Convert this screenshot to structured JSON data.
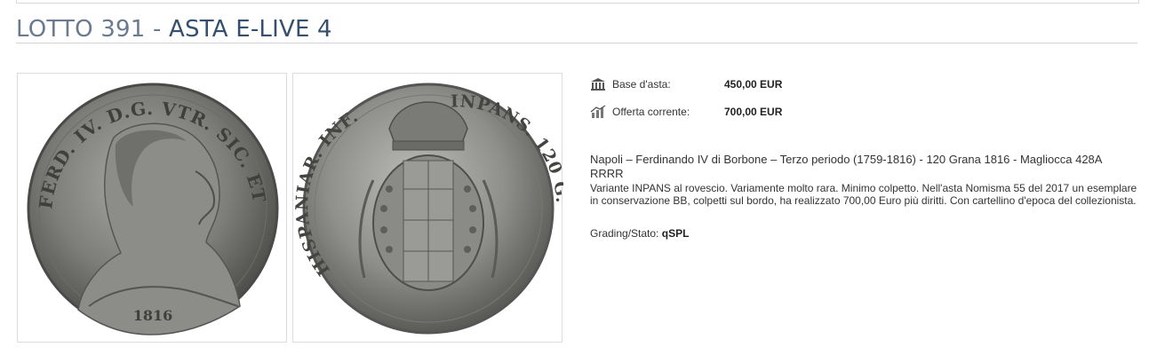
{
  "header": {
    "lot": "LOTTO 391",
    "separator": " - ",
    "auction": "ASTA E-LIVE 4"
  },
  "images": [
    {
      "name": "coin-obverse",
      "legend": "FERD. IV. D.G. VTR. SIC. ET HIER. REX",
      "date": "1816"
    },
    {
      "name": "coin-reverse",
      "legend": "HISPANIAR. INF. INPANS. 120 G. ",
      "mark": "INPANS"
    }
  ],
  "info": {
    "base_label": "Base d'asta:",
    "base_value": "450,00 EUR",
    "offer_label": "Offerta corrente:",
    "offer_value": "700,00 EUR"
  },
  "description": {
    "main": "Napoli – Ferdinando IV di Borbone – Terzo periodo (1759-1816) - 120 Grana 1816 - Magliocca 428A RRRR",
    "sub": "Variante INPANS al rovescio. Variamente molto rara. Minimo colpetto. Nell'asta Nomisma 55 del 2017 un esemplare in conservazione BB, colpetti sul bordo, ha realizzato 700,00 Euro più diritti. Con cartellino d'epoca del collezionista.",
    "grading_label": "Grading/Stato:",
    "grading_value": "qSPL"
  },
  "icons": {
    "base": "bank-icon",
    "offer": "bar-chart-icon"
  },
  "colors": {
    "title_lot": "#6b7a8f",
    "title_auction": "#34506e"
  }
}
